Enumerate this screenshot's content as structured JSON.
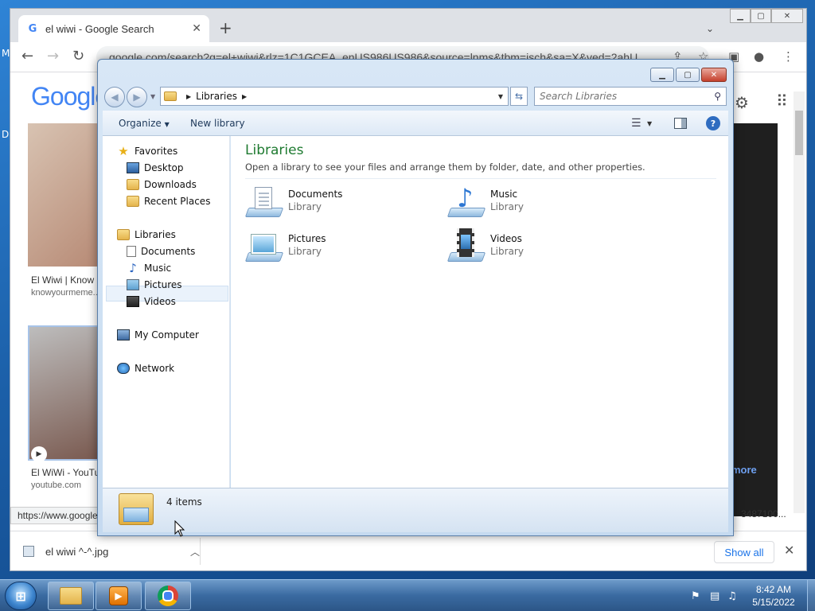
{
  "desktop": {
    "letters": [
      "M",
      "D"
    ]
  },
  "chrome": {
    "tab_title": "el wiwi - Google Search",
    "tab_favicon": "G",
    "new_tab_symbol": "+",
    "url": "google.com/search?q=el+wiwi&rlz=1C1GCEA_enUS986US986&source=lnms&tbm=isch&sa=X&ved=2ahU...",
    "page": {
      "logo_text": "Google",
      "results": [
        {
          "title": "El Wiwi | Know",
          "site": "knowyourmeme..."
        },
        {
          "title": "El WiWi - YouTu",
          "site": "youtube.com"
        }
      ],
      "more_text": "more"
    },
    "status_url": "https://www.google",
    "status_right": "3487100...",
    "download": {
      "file_name": "el wiwi ^-^.jpg",
      "show_all": "Show all"
    }
  },
  "explorer": {
    "address_crumb": "Libraries",
    "search_placeholder": "Search Libraries",
    "commands": {
      "organize": "Organize",
      "new_library": "New library"
    },
    "nav": {
      "favorites": {
        "label": "Favorites",
        "items": [
          "Desktop",
          "Downloads",
          "Recent Places"
        ]
      },
      "libraries": {
        "label": "Libraries",
        "items": [
          "Documents",
          "Music",
          "Pictures",
          "Videos"
        ]
      },
      "computer": "My Computer",
      "network": "Network"
    },
    "content": {
      "title": "Libraries",
      "subtitle": "Open a library to see your files and arrange them by folder, date, and other properties.",
      "items": [
        {
          "name": "Documents",
          "kind": "Library"
        },
        {
          "name": "Music",
          "kind": "Library"
        },
        {
          "name": "Pictures",
          "kind": "Library"
        },
        {
          "name": "Videos",
          "kind": "Library"
        }
      ]
    },
    "details": {
      "count": "4 items"
    }
  },
  "taskbar": {
    "clock_time": "8:42 AM",
    "clock_date": "5/15/2022"
  },
  "colors": {
    "explorer_title_green": "#1e7a30",
    "chrome_link_blue": "#1a73e8",
    "taskbar_blue": "#3a6aa1"
  }
}
